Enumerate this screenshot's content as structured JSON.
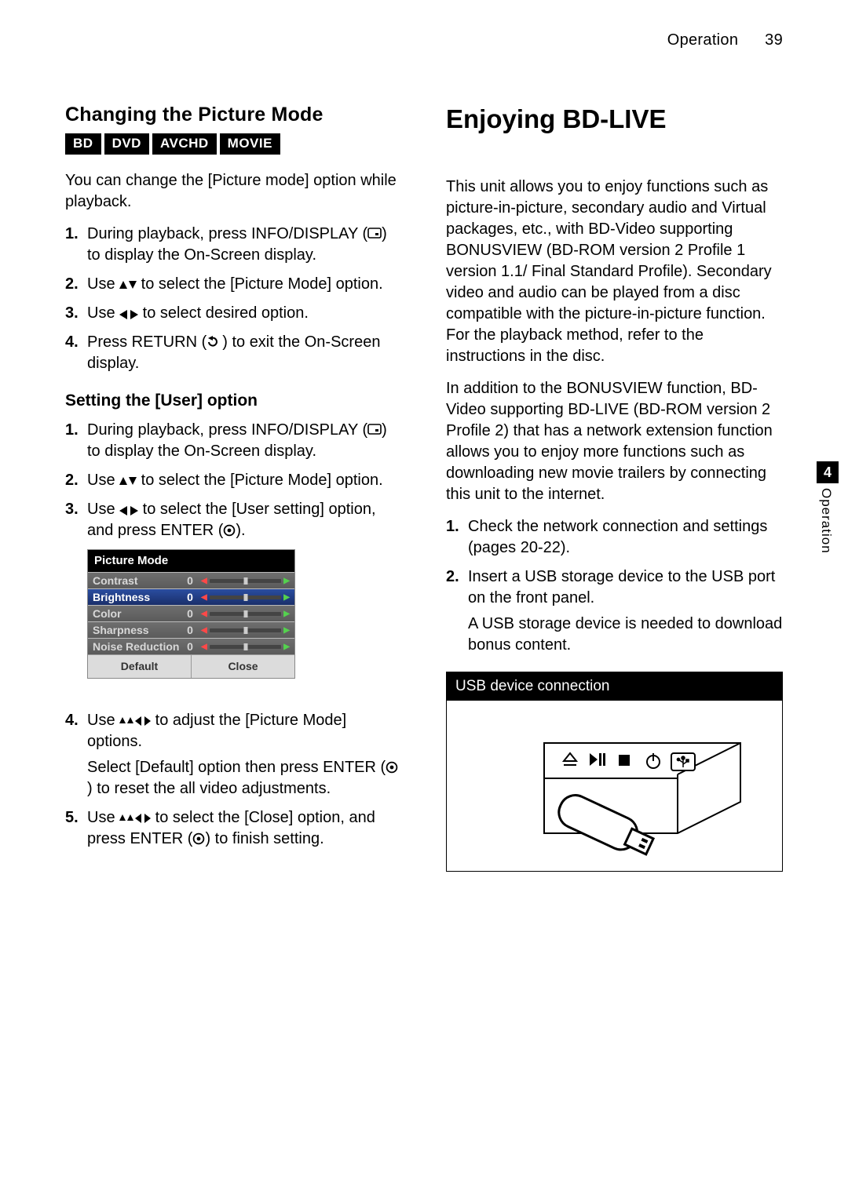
{
  "header": {
    "section": "Operation",
    "page": "39"
  },
  "side_tab": {
    "num": "4",
    "label": "Operation"
  },
  "left": {
    "h2": "Changing the Picture Mode",
    "tags": [
      "BD",
      "DVD",
      "AVCHD",
      "MOVIE"
    ],
    "intro": "You can change the [Picture mode] option while playback.",
    "steps1": [
      {
        "pre": "During playback, press INFO/DISPLAY (",
        "post": ") to display the On-Screen display."
      },
      {
        "pre": "Use ",
        "mid": " to select the [Picture Mode] option."
      },
      {
        "pre": "Use ",
        "mid": " to select desired option."
      },
      {
        "pre": "Press RETURN (",
        "post": ") to exit the On-Screen display."
      }
    ],
    "h3": "Setting the [User] option",
    "steps2": [
      {
        "pre": "During playback, press INFO/DISPLAY (",
        "post": ") to display the On-Screen display."
      },
      {
        "pre": "Use ",
        "mid": " to select the [Picture Mode] option."
      },
      {
        "pre": "Use ",
        "mid": " to select the [User setting] option, and press ENTER (",
        "post": ")."
      },
      {
        "pre": "Use ",
        "mid": " to adjust the [Picture Mode] options.",
        "sub": "Select [Default] option then press ENTER (",
        "sub_post": ") to reset the all video adjustments."
      },
      {
        "pre": "Use ",
        "mid": " to select the [Close] option, and press ENTER (",
        "post": ") to finish setting."
      }
    ],
    "osd": {
      "title": "Picture Mode",
      "rows": [
        {
          "label": "Contrast",
          "val": "0"
        },
        {
          "label": "Brightness",
          "val": "0",
          "sel": true
        },
        {
          "label": "Color",
          "val": "0"
        },
        {
          "label": "Sharpness",
          "val": "0"
        },
        {
          "label": "Noise Reduction",
          "val": "0"
        }
      ],
      "footer": [
        "Default",
        "Close"
      ]
    }
  },
  "right": {
    "h1": "Enjoying BD-LIVE",
    "p1": "This unit allows you to enjoy functions such as picture-in-picture, secondary audio and Virtual packages, etc., with BD-Video supporting BONUSVIEW (BD-ROM version 2 Profile 1 version 1.1/ Final Standard Profile). Secondary video and audio can be played from a disc compatible with the picture-in-picture function. For the playback method, refer to the instructions in the disc.",
    "p2": "In addition to the BONUSVIEW function, BD-Video supporting BD-LIVE (BD-ROM version 2 Profile 2) that has a network extension function allows you to enjoy more functions such as downloading new movie trailers by connecting this unit to the internet.",
    "steps": [
      {
        "text": "Check the network connection and settings (pages 20-22)."
      },
      {
        "text": "Insert a USB storage device to the USB port on the front panel.",
        "sub": "A USB storage device is needed to download bonus content."
      }
    ],
    "usb_title": "USB device connection"
  }
}
